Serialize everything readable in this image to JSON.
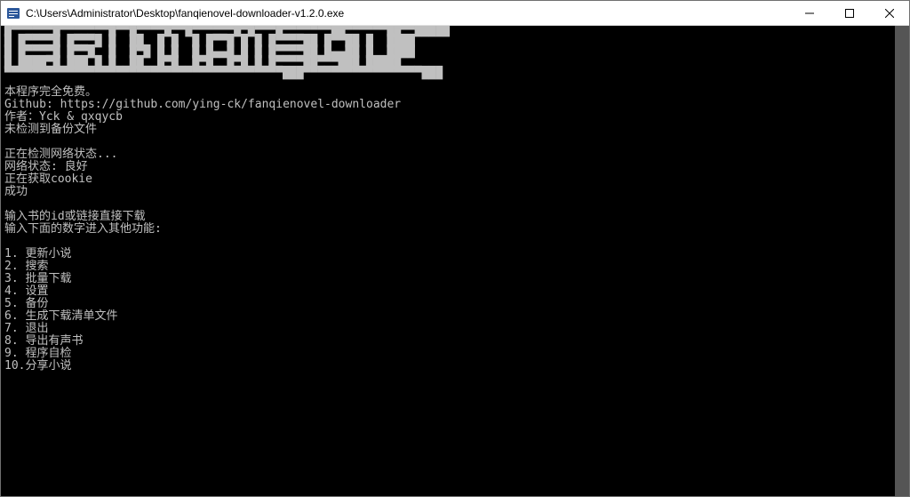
{
  "titlebar": {
    "path": "C:\\Users\\Administrator\\Desktop\\fanqienovel-downloader-v1.2.0.exe"
  },
  "console": {
    "ascii_art": "█▀▀▀▀▀▀█▀▀▀▀▀▀▀█▀▀█▀▀▀▀█▀▀█▀▀▀▀▀▀█▀█▀▀▀█▀▀▀▀▀▀▀██▀▀▀▀▀▀██▀▀█████\n█ █▀▀▀▀█ █▀▀▀█ █  ██  █ █  █ █▀▀█ █ █ █▀▀▀▀██ █▀▀██ █  ████\n█ █▀▀▀▀█ █▀▀█  █  █▀█ █ █  █ █▄▄█ █ █ █▀▀▀▀██ █▄▄██ █  ████\n█ ████▀█ ███ █ █  ██  █▀█  █▀█  █▀█ █ █▀▀▀▀██▀▀▀███ █████\n▀▀▀▀▀▀▀▀▀▀▀▀▀▀▀▀▀▀▀▀▀▀▀▀▀▀▀▀▀▀▀▀▀▀▀▀▀▀▀▀███▀▀▀▀▀▀▀▀▀▀▀▀▀▀▀▀▀███",
    "line_free": "本程序完全免费。",
    "line_github": "Github: https://github.com/ying-ck/fanqienovel-downloader",
    "line_author": "作者：Yck & qxqycb",
    "line_nobackup": "未检测到备份文件",
    "line_checknet": "正在检测网络状态...",
    "line_netstatus": "网络状态: 良好",
    "line_getcookie": "正在获取cookie",
    "line_success": "成功",
    "line_input1": "输入书的id或链接直接下载",
    "line_input2": "输入下面的数字进入其他功能:",
    "menu": [
      {
        "num": "1",
        "label": "更新小说"
      },
      {
        "num": "2",
        "label": "搜索"
      },
      {
        "num": "3",
        "label": "批量下载"
      },
      {
        "num": "4",
        "label": "设置"
      },
      {
        "num": "5",
        "label": "备份"
      },
      {
        "num": "6",
        "label": "生成下载清单文件"
      },
      {
        "num": "7",
        "label": "退出"
      },
      {
        "num": "8",
        "label": "导出有声书"
      },
      {
        "num": "9",
        "label": "程序自检"
      },
      {
        "num": "10",
        "label": "分享小说"
      }
    ]
  }
}
